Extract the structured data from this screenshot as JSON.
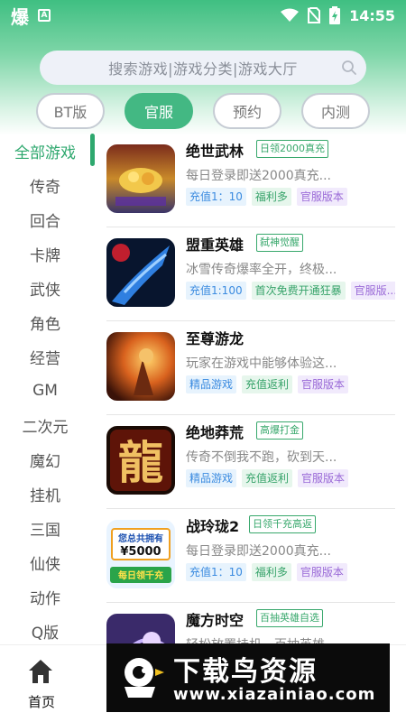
{
  "status_bar": {
    "app_glyph": "爆",
    "a_label": "A",
    "time": "14:55"
  },
  "search": {
    "placeholder": "搜索游戏|游戏分类|游戏大厅"
  },
  "tabs": [
    {
      "label": "BT版",
      "active": false
    },
    {
      "label": "官服",
      "active": true
    },
    {
      "label": "预约",
      "active": false
    },
    {
      "label": "内测",
      "active": false
    }
  ],
  "categories": [
    "全部游戏",
    "传奇",
    "回合",
    "卡牌",
    "武侠",
    "角色",
    "经营",
    "GM",
    "二次元",
    "魔幻",
    "挂机",
    "三国",
    "仙侠",
    "动作",
    "Q版"
  ],
  "games": [
    {
      "name": "绝世武林",
      "badge": "日领2000真充",
      "desc": "每日登录即送2000真充...",
      "tags": [
        "充值1：10",
        "福利多",
        "官服版本"
      ]
    },
    {
      "name": "盟重英雄",
      "badge": "弑神觉醒",
      "desc": "冰雪传奇爆率全开，终极...",
      "tags": [
        "充值1:100",
        "首次免费开通狂暴",
        "官服版..."
      ]
    },
    {
      "name": "至尊游龙",
      "badge": "",
      "desc": "玩家在游戏中能够体验这...",
      "tags": [
        "精品游戏",
        "充值返利",
        "官服版本"
      ]
    },
    {
      "name": "绝地莽荒",
      "badge": "高爆打金",
      "desc": "传奇不倒我不跑，砍到天...",
      "tags": [
        "精品游戏",
        "充值返利",
        "官服版本"
      ]
    },
    {
      "name": "战玲珑2",
      "badge": "日领千充高返",
      "desc": "每日登录即送2000真充...",
      "tags": [
        "充值1：10",
        "福利多",
        "官服版本"
      ]
    },
    {
      "name": "魔方时空",
      "badge": "百抽英雄自选",
      "desc": "轻松放置挂机，百抽英雄",
      "tags": []
    }
  ],
  "thumb_text": {
    "long": "龍",
    "money": "您总共拥有",
    "amount": "¥5000",
    "daily": "每日领千充"
  },
  "bottom_nav": {
    "home_label": "首页"
  },
  "watermark": {
    "title": "下载鸟资源",
    "url": "www.xiazainiao.com"
  },
  "colors": {
    "accent": "#43b883",
    "tab_border": "#c6ccd4",
    "tag_blue": "#3b8be0",
    "tag_green": "#37a36a",
    "tag_purple": "#9a6ad7"
  }
}
